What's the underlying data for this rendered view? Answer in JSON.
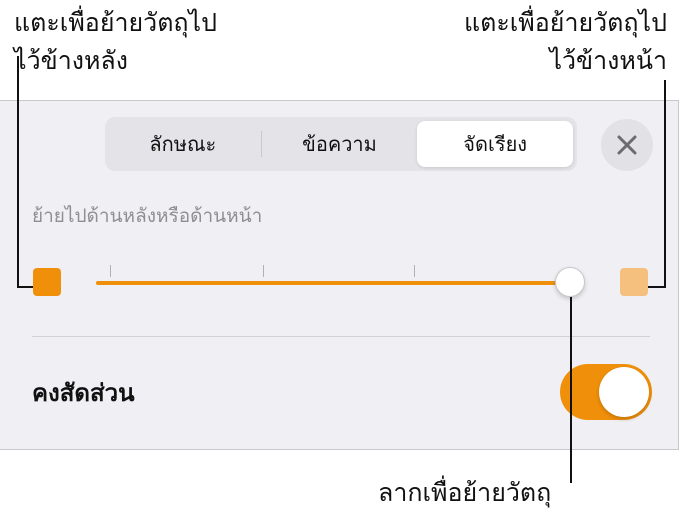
{
  "callouts": {
    "back_line1": "แตะเพื่อย้ายวัตถุไป",
    "back_line2": "ไว้ข้างหลัง",
    "front_line1": "แตะเพื่อย้ายวัตถุไป",
    "front_line2": "ไว้ข้างหน้า",
    "drag": "ลากเพื่อย้ายวัตถุ"
  },
  "tabs": [
    {
      "label": "ลักษณะ",
      "active": false
    },
    {
      "label": "ข้อความ",
      "active": false
    },
    {
      "label": "จัดเรียง",
      "active": true
    }
  ],
  "close_icon": "close-icon",
  "arrange": {
    "section_label": "ย้ายไปด้านหลังหรือด้านหน้า",
    "slider_value_fraction": 1.0,
    "tick_count": 3,
    "back_icon": "square-back-icon",
    "front_icon": "square-front-icon"
  },
  "constrain": {
    "label": "คงสัดส่วน",
    "toggle_on": true
  },
  "colors": {
    "accent": "#f0900a",
    "accent_light": "#f5c07e",
    "panel_bg": "#efeff4"
  }
}
